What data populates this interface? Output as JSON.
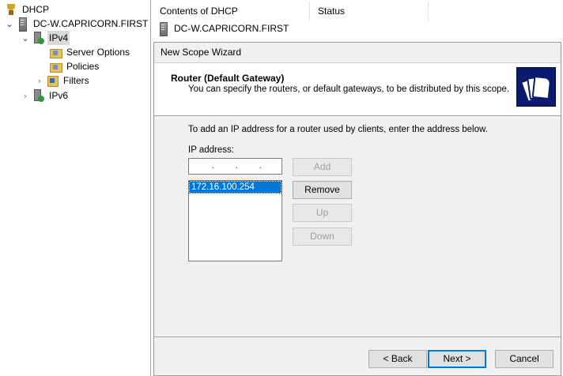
{
  "tree": {
    "root": "DHCP",
    "server": "DC-W.CAPRICORN.FIRST",
    "ipv4": "IPv4",
    "server_options": "Server Options",
    "policies": "Policies",
    "filters": "Filters",
    "ipv6": "IPv6"
  },
  "list_pane": {
    "columns": [
      "Contents of DHCP",
      "Status"
    ],
    "rows": [
      "DC-W.CAPRICORN.FIRST"
    ]
  },
  "wizard": {
    "title": "New Scope Wizard",
    "heading": "Router (Default Gateway)",
    "subheading": "You can specify the routers, or default gateways, to be distributed by this scope.",
    "instruction": "To add an IP address for a router used by clients, enter the address below.",
    "ip_label": "IP address:",
    "ip_value": "",
    "router_list": [
      "172.16.100.254"
    ],
    "buttons": {
      "add": "Add",
      "remove": "Remove",
      "up": "Up",
      "down": "Down",
      "back": "< Back",
      "next": "Next >",
      "cancel": "Cancel"
    }
  },
  "colors": {
    "selection": "#0078d7",
    "logo_bg": "#0b1c6e",
    "dialog_bg": "#f0f0f0"
  },
  "icons": {
    "dhcp": "trophy-icon",
    "server": "server-icon",
    "ip": "network-icon",
    "folder": "folder-icon",
    "filter": "filter-icon",
    "wizard_logo": "documents-icon"
  }
}
